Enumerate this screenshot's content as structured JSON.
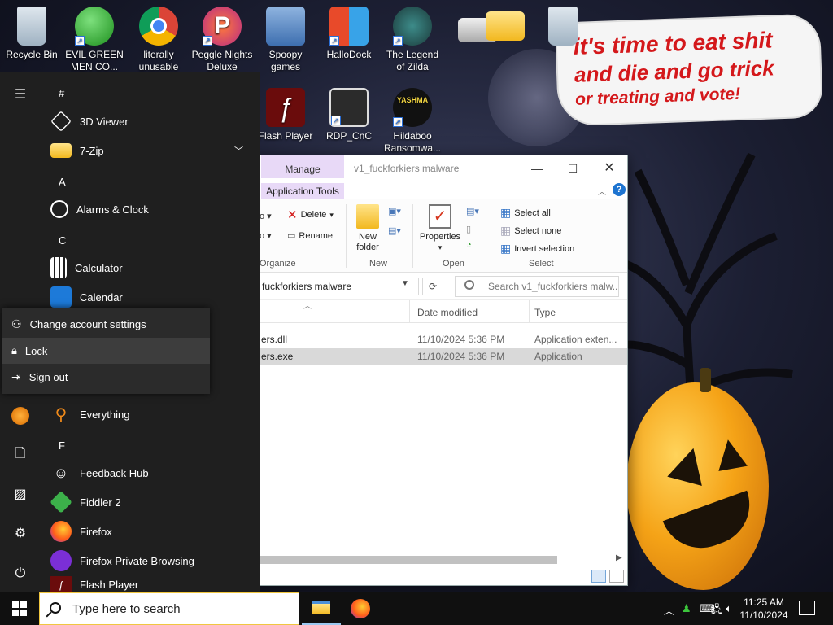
{
  "desktop": {
    "icons": [
      {
        "label": "Recycle Bin",
        "icon": "recycle-bin-icon"
      },
      {
        "label": "EVIL GREEN MEN CO...",
        "icon": "messenger-people-icon"
      },
      {
        "label": "literally unusable",
        "icon": "chrome-icon"
      },
      {
        "label": "Peggle Nights Deluxe",
        "icon": "peggle-icon"
      },
      {
        "label": "Spoopy games",
        "icon": "folder-games-icon"
      },
      {
        "label": "HalloDock",
        "icon": "hallodock-icon"
      },
      {
        "label": "The Legend of Zilda",
        "icon": "zilda-icon"
      },
      {
        "label": "Flash Player",
        "icon": "flash-icon"
      },
      {
        "label": "RDP_CnC",
        "icon": "rdp-icon"
      },
      {
        "label": "Hildaboo Ransomwa...",
        "icon": "hildaboo-icon"
      }
    ],
    "speech_bubble": [
      "it's time to eat shit",
      "and die and go trick",
      "or treating and vote!"
    ]
  },
  "explorer": {
    "manage_tab": "Manage",
    "title": "v1_fuckforkiers malware",
    "context_tab": "Application Tools",
    "ribbon": {
      "delete": "Delete",
      "rename": "Rename",
      "new_folder": "New folder",
      "properties": "Properties",
      "select_all": "Select all",
      "select_none": "Select none",
      "invert_selection": "Invert selection",
      "groups": {
        "organize": "Organize",
        "new": "New",
        "open": "Open",
        "select": "Select"
      }
    },
    "address": "fuckforkiers malware",
    "search_placeholder": "Search v1_fuckforkiers malw...",
    "columns": {
      "date": "Date modified",
      "type": "Type"
    },
    "files": [
      {
        "name": "ers.dll",
        "date": "11/10/2024 5:36 PM",
        "type": "Application exten...",
        "selected": false
      },
      {
        "name": "ers.exe",
        "date": "11/10/2024 5:36 PM",
        "type": "Application",
        "selected": true
      }
    ]
  },
  "start_menu": {
    "letters": {
      "hash": "#",
      "a": "A",
      "c": "C",
      "f": "F"
    },
    "apps": [
      {
        "label": "3D Viewer",
        "icon": "cube-icon"
      },
      {
        "label": "7-Zip",
        "icon": "folder-icon"
      },
      {
        "label": "Alarms & Clock",
        "icon": "alarm-clock-icon"
      },
      {
        "label": "Calculator",
        "icon": "calculator-icon"
      },
      {
        "label": "Calendar",
        "icon": "calendar-icon"
      },
      {
        "label": "Everything",
        "icon": "magnifier-icon"
      },
      {
        "label": "Feedback Hub",
        "icon": "feedback-icon"
      },
      {
        "label": "Fiddler 2",
        "icon": "fiddler-icon"
      },
      {
        "label": "Firefox",
        "icon": "firefox-icon"
      },
      {
        "label": "Firefox Private Browsing",
        "icon": "private-mask-icon"
      },
      {
        "label": "Flash Player",
        "icon": "flash-icon"
      }
    ],
    "account_popup": {
      "change_settings": "Change account settings",
      "lock": "Lock",
      "sign_out": "Sign out"
    }
  },
  "taskbar": {
    "search_placeholder": "Type here to search",
    "time": "11:25 AM",
    "date": "11/10/2024"
  },
  "colors": {
    "accent": "#0078d7",
    "start_bg": "#1f1f1f",
    "bubble_text": "#d4181b",
    "manage_tab": "#e8d9f7"
  }
}
